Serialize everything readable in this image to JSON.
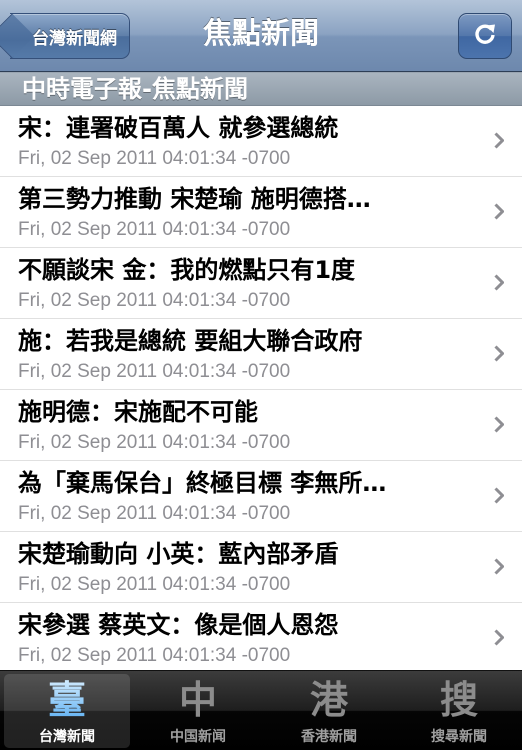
{
  "nav": {
    "title": "焦點新聞",
    "back_label": "台灣新聞網",
    "refresh_icon": "refresh-icon"
  },
  "section": {
    "header": "中時電子報-焦點新聞"
  },
  "articles": [
    {
      "title": "宋：連署破百萬人 就參選總統",
      "date": "Fri, 02 Sep 2011 04:01:34 -0700"
    },
    {
      "title": "第三勢力推動 宋楚瑜 施明德搭…",
      "date": "Fri, 02 Sep 2011 04:01:34 -0700"
    },
    {
      "title": "不願談宋 金：我的燃點只有1度",
      "date": "Fri, 02 Sep 2011 04:01:34 -0700"
    },
    {
      "title": "施：若我是總統 要組大聯合政府",
      "date": "Fri, 02 Sep 2011 04:01:34 -0700"
    },
    {
      "title": "施明德：宋施配不可能",
      "date": "Fri, 02 Sep 2011 04:01:34 -0700"
    },
    {
      "title": "為「棄馬保台」終極目標 李無所…",
      "date": "Fri, 02 Sep 2011 04:01:34 -0700"
    },
    {
      "title": "宋楚瑜動向  小英：藍內部矛盾",
      "date": "Fri, 02 Sep 2011 04:01:34 -0700"
    },
    {
      "title": "宋參選  蔡英文：像是個人恩怨",
      "date": "Fri, 02 Sep 2011 04:01:34 -0700"
    }
  ],
  "tabs": [
    {
      "icon": "臺",
      "label": "台灣新聞",
      "active": true
    },
    {
      "icon": "中",
      "label": "中国新闻",
      "active": false
    },
    {
      "icon": "港",
      "label": "香港新聞",
      "active": false
    },
    {
      "icon": "搜",
      "label": "搜尋新聞",
      "active": false
    }
  ],
  "colors": {
    "navbar": "#7b95b8",
    "active_tab_icon": "#7fc3ff",
    "date_text": "#8e8e93",
    "chevron": "#8e8e93"
  }
}
